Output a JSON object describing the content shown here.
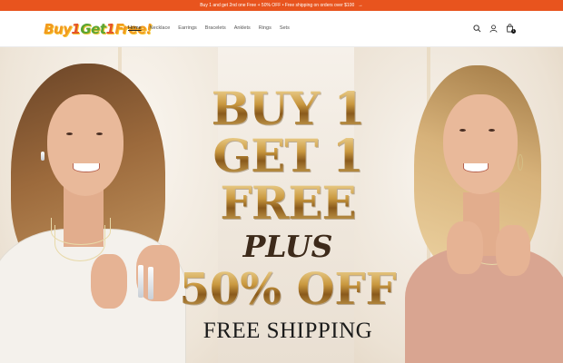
{
  "announcement": {
    "text": "Buy 1 and get 2nd one Free + 50% OFF • Free shipping on orders over $100",
    "arrow": "→"
  },
  "header": {
    "logo": {
      "part1": "Buy",
      "part2": "1",
      "part3": "Get",
      "part4": "1",
      "part5": "Free!"
    },
    "nav": [
      "Home",
      "Necklace",
      "Earrings",
      "Bracelets",
      "Anklets",
      "Rings",
      "Sets"
    ],
    "active_nav": "Home",
    "icons": [
      "search-icon",
      "account-icon",
      "cart-icon"
    ],
    "cart_count": "1"
  },
  "hero": {
    "line1": "BUY 1",
    "line2": "GET 1",
    "line3": "FREE",
    "plus": "PLUS",
    "offer": "50% OFF",
    "shipping": "FREE SHIPPING"
  },
  "colors": {
    "announcement_bg": "#e8541e",
    "gold": "#c9983f",
    "dark_text": "#1b1b1b"
  }
}
